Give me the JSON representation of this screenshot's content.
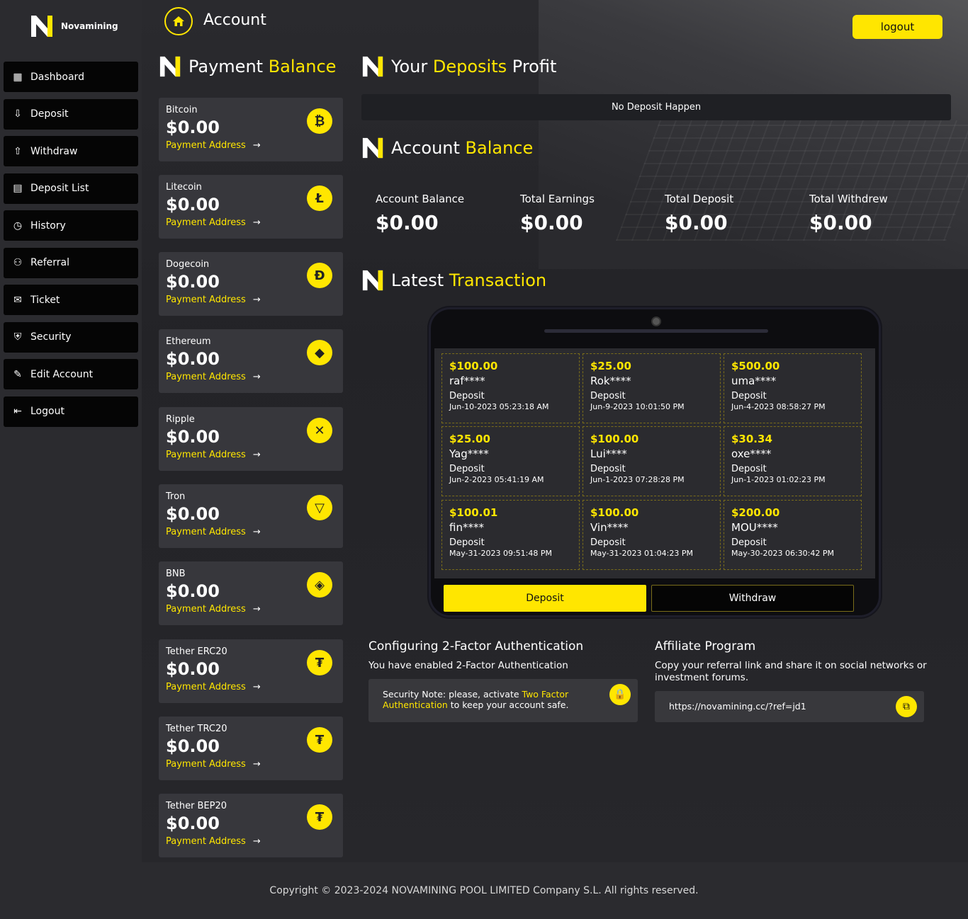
{
  "brand": {
    "name": "Novamining",
    "logo_letter": "N"
  },
  "sidebar": {
    "items": [
      {
        "label": "Dashboard",
        "icon": "dashboard-icon"
      },
      {
        "label": "Deposit",
        "icon": "deposit-icon"
      },
      {
        "label": "Withdraw",
        "icon": "withdraw-icon"
      },
      {
        "label": "Deposit List",
        "icon": "deposit-list-icon"
      },
      {
        "label": "History",
        "icon": "history-icon"
      },
      {
        "label": "Referral",
        "icon": "referral-icon"
      },
      {
        "label": "Ticket",
        "icon": "ticket-icon"
      },
      {
        "label": "Security",
        "icon": "security-icon"
      },
      {
        "label": "Edit Account",
        "icon": "edit-account-icon"
      },
      {
        "label": "Logout",
        "icon": "logout-icon"
      }
    ]
  },
  "header": {
    "title": "Account",
    "logout_label": "logout"
  },
  "payment_balance": {
    "title_a": "Payment",
    "title_b": "Balance",
    "coins": [
      {
        "name": "Bitcoin",
        "balance": "$0.00",
        "link": "Payment Address",
        "symbol": "₿"
      },
      {
        "name": "Litecoin",
        "balance": "$0.00",
        "link": "Payment Address",
        "symbol": "Ł"
      },
      {
        "name": "Dogecoin",
        "balance": "$0.00",
        "link": "Payment Address",
        "symbol": "Ð"
      },
      {
        "name": "Ethereum",
        "balance": "$0.00",
        "link": "Payment Address",
        "symbol": "◆"
      },
      {
        "name": "Ripple",
        "balance": "$0.00",
        "link": "Payment Address",
        "symbol": "✕"
      },
      {
        "name": "Tron",
        "balance": "$0.00",
        "link": "Payment Address",
        "symbol": "▽"
      },
      {
        "name": "BNB",
        "balance": "$0.00",
        "link": "Payment Address",
        "symbol": "◈"
      },
      {
        "name": "Tether ERC20",
        "balance": "$0.00",
        "link": "Payment Address",
        "symbol": "₮"
      },
      {
        "name": "Tether TRC20",
        "balance": "$0.00",
        "link": "Payment Address",
        "symbol": "₮"
      },
      {
        "name": "Tether BEP20",
        "balance": "$0.00",
        "link": "Payment Address",
        "symbol": "₮"
      }
    ]
  },
  "deposits_profit": {
    "title_a": "Your",
    "title_b": "Deposits",
    "title_c": "Profit",
    "empty_text": "No Deposit Happen"
  },
  "account_balance": {
    "title_a": "Account",
    "title_b": "Balance",
    "items": [
      {
        "label": "Account Balance",
        "value": "$0.00"
      },
      {
        "label": "Total Earnings",
        "value": "$0.00"
      },
      {
        "label": "Total Deposit",
        "value": "$0.00"
      },
      {
        "label": "Total Withdrew",
        "value": "$0.00"
      }
    ]
  },
  "latest_transaction": {
    "title_a": "Latest",
    "title_b": "Transaction",
    "items": [
      {
        "amount": "$100.00",
        "user": "raf****",
        "type": "Deposit",
        "date": "Jun-10-2023 05:23:18 AM"
      },
      {
        "amount": "$25.00",
        "user": "Rok****",
        "type": "Deposit",
        "date": "Jun-9-2023 10:01:50 PM"
      },
      {
        "amount": "$500.00",
        "user": "uma****",
        "type": "Deposit",
        "date": "Jun-4-2023 08:58:27 PM"
      },
      {
        "amount": "$25.00",
        "user": "Yag****",
        "type": "Deposit",
        "date": "Jun-2-2023 05:41:19 AM"
      },
      {
        "amount": "$100.00",
        "user": "Lui****",
        "type": "Deposit",
        "date": "Jun-1-2023 07:28:28 PM"
      },
      {
        "amount": "$30.34",
        "user": "oxe****",
        "type": "Deposit",
        "date": "Jun-1-2023 01:02:23 PM"
      },
      {
        "amount": "$100.01",
        "user": "fin****",
        "type": "Deposit",
        "date": "May-31-2023 09:51:48 PM"
      },
      {
        "amount": "$100.00",
        "user": "Vin****",
        "type": "Deposit",
        "date": "May-31-2023 01:04:23 PM"
      },
      {
        "amount": "$200.00",
        "user": "MOU****",
        "type": "Deposit",
        "date": "May-30-2023 06:30:42 PM"
      }
    ],
    "deposit_label": "Deposit",
    "withdraw_label": "Withdraw"
  },
  "two_factor": {
    "title": "Configuring 2-Factor Authentication",
    "status": "You have enabled 2-Factor Authentication",
    "note_a": "Security Note: please, activate ",
    "note_link": "Two Factor Authentication",
    "note_b": " to keep your account safe."
  },
  "affiliate": {
    "title": "Affiliate Program",
    "text": "Copy your referral link and share it on social networks or investment forums.",
    "link": "https://novamining.cc/?ref=jd1"
  },
  "footer": {
    "text": "Copyright © 2023-2024 NOVAMINING POOL LIMITED Company S.L. All rights reserved."
  },
  "colors": {
    "accent": "#ffe600",
    "bg": "#2b2b2f",
    "card": "#37373c",
    "nav": "#050505"
  }
}
